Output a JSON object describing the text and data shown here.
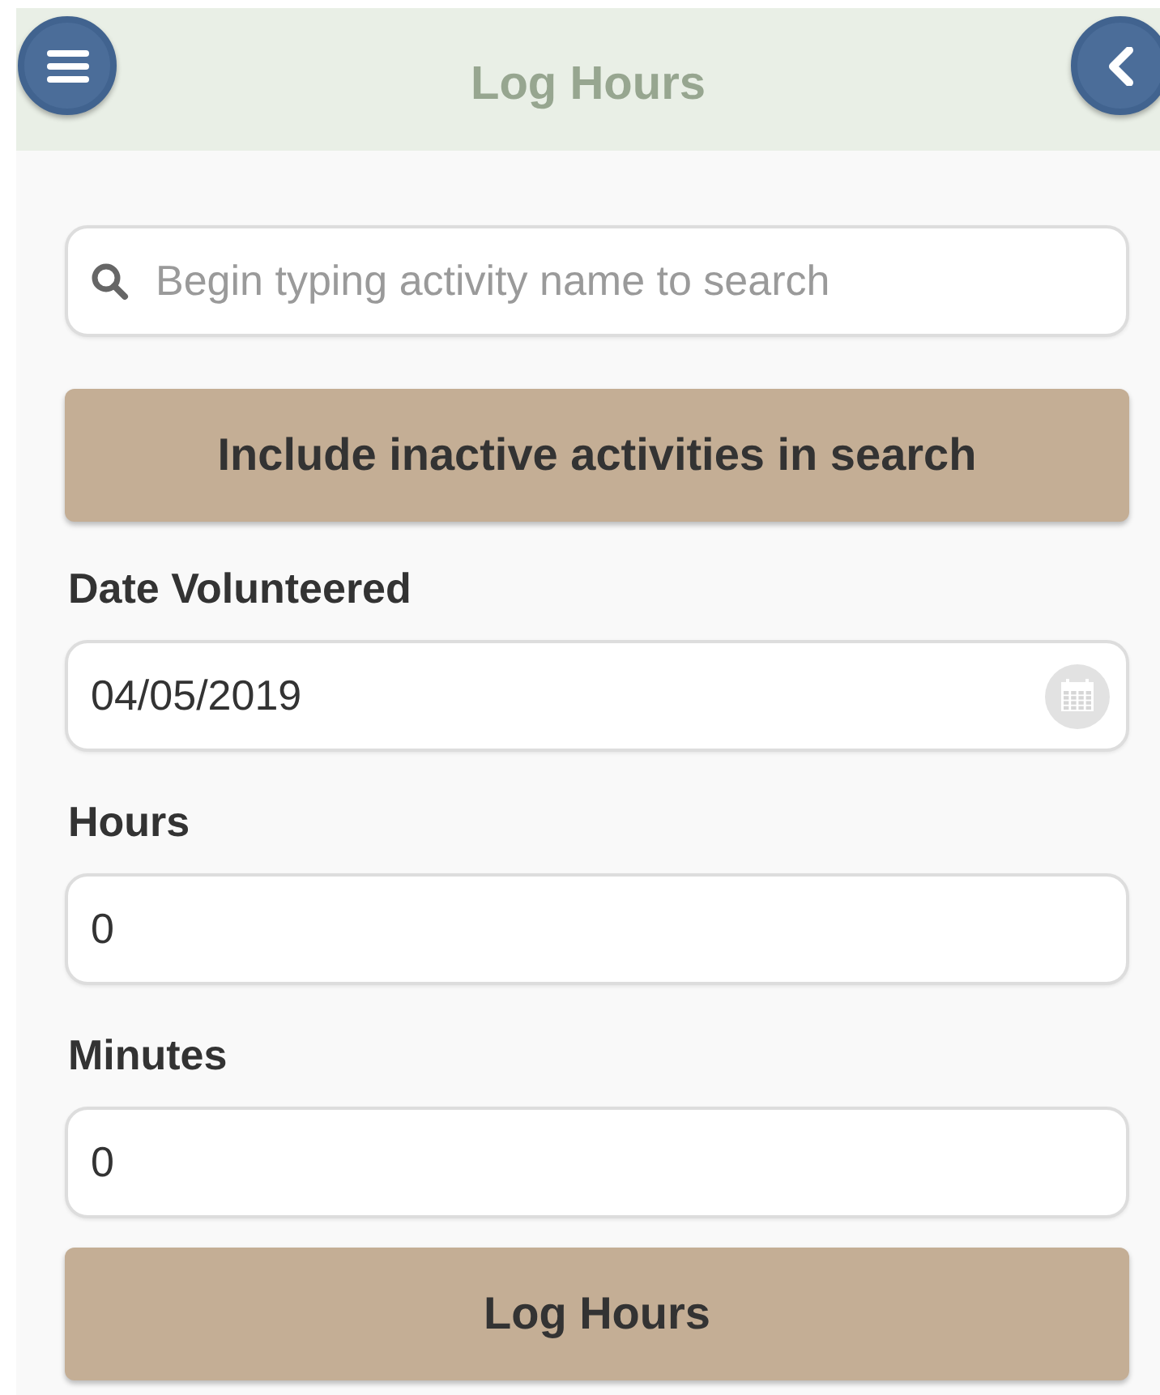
{
  "header": {
    "title": "Log Hours"
  },
  "search": {
    "placeholder": "Begin typing activity name to search"
  },
  "include_button": {
    "label": "Include inactive activities in search"
  },
  "fields": [
    {
      "label": "Date Volunteered",
      "value": "04/05/2019",
      "kind": "date"
    },
    {
      "label": "Hours",
      "value": "0",
      "kind": "number"
    },
    {
      "label": "Minutes",
      "value": "0",
      "kind": "number"
    }
  ],
  "submit_button": {
    "label": "Log Hours"
  }
}
